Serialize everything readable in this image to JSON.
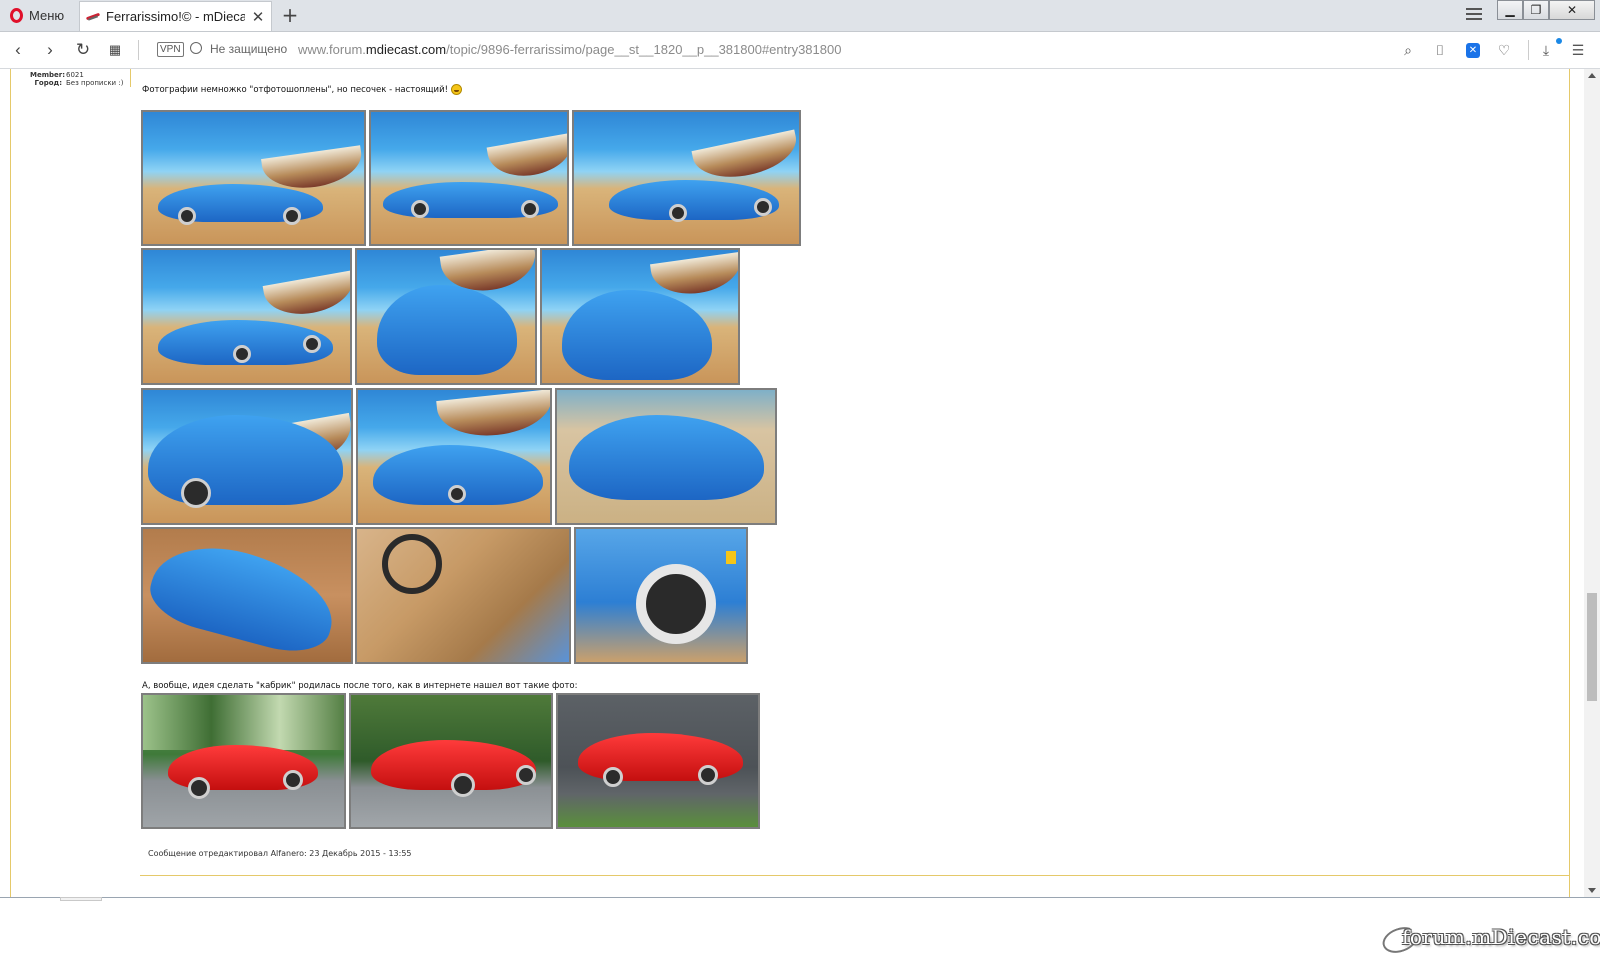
{
  "browser": {
    "menu_label": "Меню",
    "tab_title": "Ferrarissimo!© - mDiecast",
    "new_tab_glyph": "+",
    "tab_close_glyph": "✕",
    "vpn_label": "VPN",
    "security_label": "Не защищено",
    "url_prefix": "www.forum.",
    "url_domain": "mdiecast.com",
    "url_path": "/topic/9896-ferrarissimo/page__st__1820__p__381800#entry381800"
  },
  "profile": {
    "member_key": "Member:",
    "member_value": "6021",
    "city_key": "Город:",
    "city_value": "Без прописки :)"
  },
  "post": {
    "intro_text": "Фотографии немножко \"отфотошоплены\", но песочек - настоящий!",
    "second_text": "А, вообще, идея сделать \"кабрик\" родилась после того, как в интернете нашел вот такие фото:",
    "edit_note": "Сообщение отредактировал Alfanero: 23 Декабрь 2015 - 13:55"
  },
  "colors": {
    "accent_gold": "#e5c96a",
    "opera_red": "#e0102a",
    "model_blue": "#2f87d6",
    "car_red": "#e01818"
  },
  "icons": [
    "opera-icon",
    "back-icon",
    "forward-icon",
    "reload-icon",
    "speed-dial-icon",
    "globe-icon",
    "search-icon",
    "camera-icon",
    "adblock-shield-icon",
    "heart-icon",
    "download-icon",
    "easy-setup-icon"
  ],
  "watermark": "forum.mDiecast.com"
}
